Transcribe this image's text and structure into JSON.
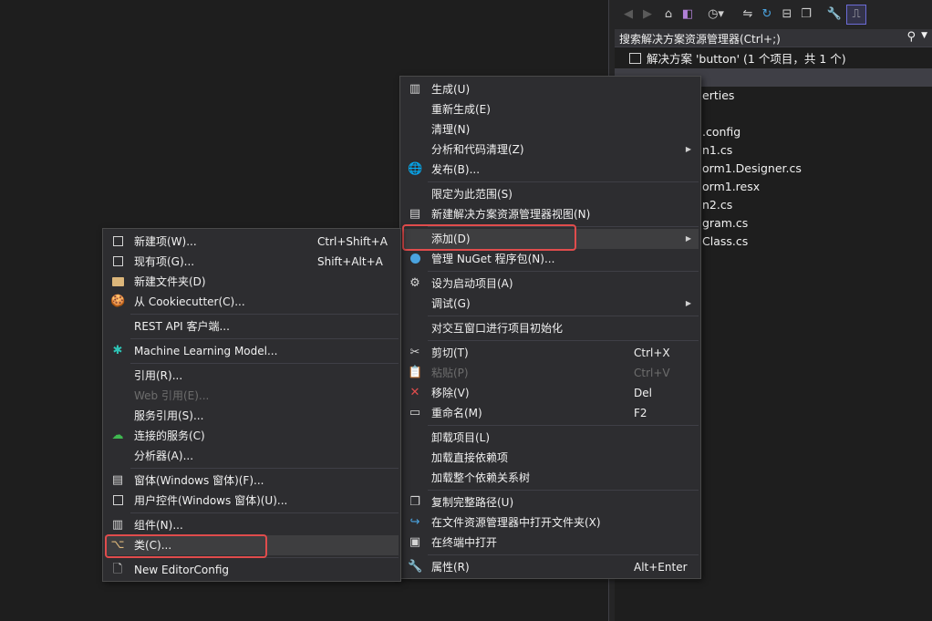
{
  "solution_explorer": {
    "search_placeholder": "搜索解决方案资源管理器(Ctrl+;)",
    "solution_label": "解决方案 'button' (1 个项目，共 1 个)",
    "items": [
      "erties",
      ".config",
      "n1.cs",
      "orm1.Designer.cs",
      "orm1.resx",
      "n2.cs",
      "gram.cs",
      "Class.cs"
    ],
    "toolbar_icons": [
      "back-icon",
      "forward-icon",
      "home-icon",
      "vs-solution-icon",
      "history-icon",
      "sync-icon",
      "refresh-icon",
      "collapse-icon",
      "copy-icon",
      "wrench-icon",
      "preview-icon"
    ]
  },
  "context_menu": {
    "items": [
      {
        "label": "生成(U)",
        "icon": "build-icon"
      },
      {
        "label": "重新生成(E)"
      },
      {
        "label": "清理(N)"
      },
      {
        "label": "分析和代码清理(Z)",
        "submenu": true
      },
      {
        "label": "发布(B)...",
        "icon": "globe-icon"
      },
      {
        "label": "限定为此范围(S)"
      },
      {
        "label": "新建解决方案资源管理器视图(N)",
        "icon": "new-view-icon"
      },
      {
        "label": "添加(D)",
        "submenu": true
      },
      {
        "label": "管理 NuGet 程序包(N)...",
        "icon": "nuget-icon"
      },
      {
        "label": "设为启动项目(A)",
        "icon": "gear-icon"
      },
      {
        "label": "调试(G)",
        "submenu": true
      },
      {
        "label": "对交互窗口进行项目初始化"
      },
      {
        "label": "剪切(T)",
        "shortcut": "Ctrl+X",
        "icon": "scissors-icon"
      },
      {
        "label": "粘贴(P)",
        "shortcut": "Ctrl+V",
        "disabled": true,
        "icon": "paste-icon"
      },
      {
        "label": "移除(V)",
        "shortcut": "Del",
        "icon": "remove-icon"
      },
      {
        "label": "重命名(M)",
        "shortcut": "F2",
        "icon": "rename-icon"
      },
      {
        "label": "卸载项目(L)"
      },
      {
        "label": "加载直接依赖项"
      },
      {
        "label": "加载整个依赖关系树"
      },
      {
        "label": "复制完整路径(U)",
        "icon": "copy-path-icon"
      },
      {
        "label": "在文件资源管理器中打开文件夹(X)",
        "icon": "open-folder-icon"
      },
      {
        "label": "在终端中打开",
        "icon": "terminal-icon"
      },
      {
        "label": "属性(R)",
        "shortcut": "Alt+Enter",
        "icon": "wrench-icon"
      }
    ]
  },
  "add_submenu": {
    "items": [
      {
        "label": "新建项(W)...",
        "shortcut": "Ctrl+Shift+A",
        "icon": "new-item-icon"
      },
      {
        "label": "现有项(G)...",
        "shortcut": "Shift+Alt+A",
        "icon": "existing-item-icon"
      },
      {
        "label": "新建文件夹(D)",
        "icon": "new-folder-icon"
      },
      {
        "label": "从 Cookiecutter(C)...",
        "icon": "cookiecutter-icon"
      },
      {
        "label": "REST API 客户端..."
      },
      {
        "label": "Machine Learning Model...",
        "icon": "ml-icon"
      },
      {
        "label": "引用(R)..."
      },
      {
        "label": "Web 引用(E)...",
        "disabled": true
      },
      {
        "label": "服务引用(S)..."
      },
      {
        "label": "连接的服务(C)",
        "icon": "connected-service-icon"
      },
      {
        "label": "分析器(A)..."
      },
      {
        "label": "窗体(Windows 窗体)(F)...",
        "icon": "form-icon"
      },
      {
        "label": "用户控件(Windows 窗体)(U)...",
        "icon": "user-control-icon"
      },
      {
        "label": "组件(N)...",
        "icon": "component-icon"
      },
      {
        "label": "类(C)...",
        "icon": "class-icon"
      },
      {
        "label": "New EditorConfig",
        "icon": "file-icon"
      }
    ]
  }
}
